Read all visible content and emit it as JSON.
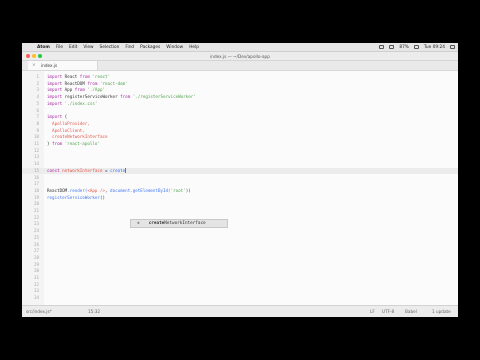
{
  "menubar": {
    "apple": "",
    "app_name": "Atom",
    "items": [
      "File",
      "Edit",
      "View",
      "Selection",
      "Find",
      "Packages",
      "Window",
      "Help"
    ],
    "battery": "87%",
    "clock": "Tue 09:24"
  },
  "window": {
    "title": "index.js — ~/Dev/apollo-app"
  },
  "tab": {
    "label": "index.js",
    "close": "×"
  },
  "editor": {
    "lines": [
      {
        "n": "1",
        "tokens": [
          {
            "t": "import ",
            "c": "kw"
          },
          {
            "t": "React ",
            "c": ""
          },
          {
            "t": "from ",
            "c": "kw"
          },
          {
            "t": "'react'",
            "c": "str"
          }
        ]
      },
      {
        "n": "2",
        "tokens": [
          {
            "t": "import ",
            "c": "kw"
          },
          {
            "t": "ReactDOM ",
            "c": ""
          },
          {
            "t": "from ",
            "c": "kw"
          },
          {
            "t": "'react-dom'",
            "c": "str"
          }
        ]
      },
      {
        "n": "3",
        "tokens": [
          {
            "t": "import ",
            "c": "kw"
          },
          {
            "t": "App ",
            "c": ""
          },
          {
            "t": "from ",
            "c": "kw"
          },
          {
            "t": "'./App'",
            "c": "str"
          }
        ]
      },
      {
        "n": "4",
        "tokens": [
          {
            "t": "import ",
            "c": "kw"
          },
          {
            "t": "registerServiceWorker ",
            "c": ""
          },
          {
            "t": "from ",
            "c": "kw"
          },
          {
            "t": "'./registerServiceWorker'",
            "c": "str"
          }
        ]
      },
      {
        "n": "5",
        "tokens": [
          {
            "t": "import ",
            "c": "kw"
          },
          {
            "t": "'./index.css'",
            "c": "str"
          }
        ]
      },
      {
        "n": "6",
        "tokens": []
      },
      {
        "n": "7",
        "tokens": [
          {
            "t": "import ",
            "c": "kw"
          },
          {
            "t": "{",
            "c": ""
          }
        ]
      },
      {
        "n": "8",
        "tokens": [
          {
            "t": "  ApolloProvider,",
            "c": "var"
          }
        ]
      },
      {
        "n": "9",
        "tokens": [
          {
            "t": "  ApolloClient,",
            "c": "var"
          }
        ]
      },
      {
        "n": "10",
        "tokens": [
          {
            "t": "  createNetworkInterface",
            "c": "var"
          }
        ]
      },
      {
        "n": "11",
        "tokens": [
          {
            "t": "} ",
            "c": ""
          },
          {
            "t": "from ",
            "c": "kw"
          },
          {
            "t": "'react-apollo'",
            "c": "str"
          }
        ]
      },
      {
        "n": "12",
        "tokens": []
      },
      {
        "n": "13",
        "tokens": []
      },
      {
        "n": "14",
        "tokens": []
      },
      {
        "n": "15",
        "current": true,
        "tokens": [
          {
            "t": "const ",
            "c": "kw"
          },
          {
            "t": "networkInterface ",
            "c": "var"
          },
          {
            "t": "= ",
            "c": ""
          },
          {
            "t": "create",
            "c": "fn"
          }
        ]
      },
      {
        "n": "16",
        "tokens": []
      },
      {
        "n": "17",
        "tokens": []
      },
      {
        "n": "18",
        "tokens": [
          {
            "t": "ReactDOM",
            "c": ""
          },
          {
            "t": ".render(",
            "c": "fn"
          },
          {
            "t": "<App />",
            "c": "var"
          },
          {
            "t": ", ",
            "c": ""
          },
          {
            "t": "document",
            "c": "fn"
          },
          {
            "t": ".getElementById(",
            "c": "fn"
          },
          {
            "t": "'root'",
            "c": "str"
          },
          {
            "t": "))",
            "c": ""
          }
        ]
      },
      {
        "n": "19",
        "tokens": [
          {
            "t": "registerServiceWorker",
            "c": "fn"
          },
          {
            "t": "()",
            "c": ""
          }
        ]
      },
      {
        "n": "20",
        "tokens": []
      },
      {
        "n": "21",
        "tokens": []
      },
      {
        "n": "22",
        "tokens": []
      },
      {
        "n": "23",
        "tokens": []
      },
      {
        "n": "24",
        "tokens": []
      },
      {
        "n": "25",
        "tokens": []
      },
      {
        "n": "26",
        "tokens": []
      },
      {
        "n": "27",
        "tokens": []
      },
      {
        "n": "28",
        "tokens": []
      },
      {
        "n": "29",
        "tokens": []
      },
      {
        "n": "30",
        "tokens": []
      },
      {
        "n": "31",
        "tokens": []
      },
      {
        "n": "32",
        "tokens": []
      },
      {
        "n": "33",
        "tokens": []
      },
      {
        "n": "34",
        "tokens": []
      }
    ]
  },
  "autocomplete": {
    "icon": "◆",
    "typed": "create",
    "rest": "NetworkInterface"
  },
  "statusbar": {
    "path": "src/index.js*",
    "position": "15:32",
    "badge": "",
    "encoding_lf": "LF",
    "encoding": "UTF-8",
    "grammar": "Babel",
    "updates": "1 update"
  }
}
